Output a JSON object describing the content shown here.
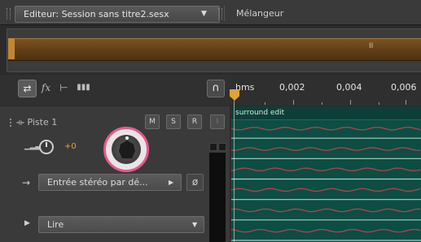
{
  "tabs": {
    "editor_label": "Editeur: Session sans titre2.sesx",
    "editor_dropdown": "▼",
    "mixer_label": "Mélangeur"
  },
  "overview": {
    "handle_glyph": "II"
  },
  "toolbar": {
    "io_glyph": "⇄",
    "fx_glyph": "fx",
    "send_glyph": "⊢",
    "eq_glyph": "▮▮▮",
    "headphone_glyph": "∩"
  },
  "ruler": {
    "labels": [
      "hms",
      "0,002",
      "0,004",
      "0,006"
    ]
  },
  "track": {
    "name_prefix": "⟛",
    "name": "Piste 1",
    "mute": "M",
    "solo": "S",
    "arm": "R",
    "rec_glyph": "I",
    "volume_icon": "▁▂▃",
    "volume_value": "+0",
    "input_arrow": "→",
    "input_label": "Entrée stéréo par dé...",
    "input_dropdown": "▶",
    "phase_glyph": "ø",
    "read_arrow": "▶",
    "read_label": "Lire",
    "read_dropdown": "▼"
  },
  "clip": {
    "label": "surround edit",
    "channels": 6
  },
  "colors": {
    "accent": "#e0a430",
    "highlight_ring": "#e8578e",
    "wave_bg": "#0d4d43",
    "waveform": "#b24447",
    "channel_line": "#c8e6dd"
  }
}
